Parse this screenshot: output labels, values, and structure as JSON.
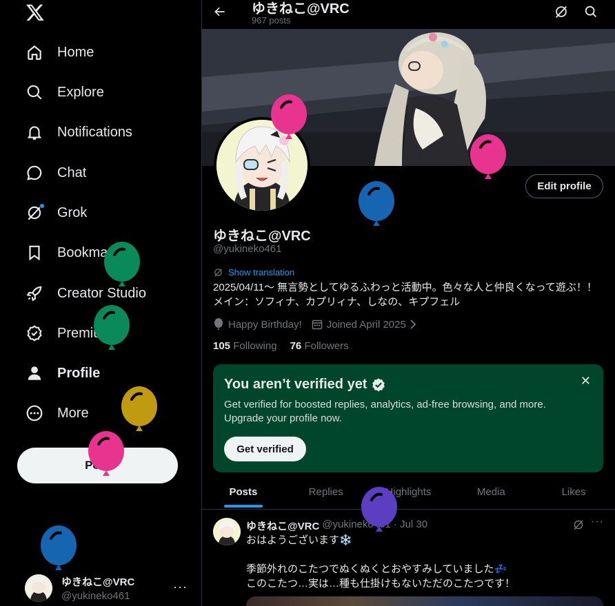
{
  "sidebar": {
    "items": [
      {
        "label": "Home",
        "icon": "home-icon"
      },
      {
        "label": "Explore",
        "icon": "search-icon"
      },
      {
        "label": "Notifications",
        "icon": "bell-icon"
      },
      {
        "label": "Chat",
        "icon": "chat-icon"
      },
      {
        "label": "Grok",
        "icon": "grok-icon"
      },
      {
        "label": "Bookmarks",
        "icon": "bookmark-icon"
      },
      {
        "label": "Creator Studio",
        "icon": "rocket-icon"
      },
      {
        "label": "Premium",
        "icon": "verified-icon"
      },
      {
        "label": "Profile",
        "icon": "person-icon"
      },
      {
        "label": "More",
        "icon": "more-circle-icon"
      }
    ],
    "post_label": "Post",
    "account": {
      "name": "ゆきねこ@VRC",
      "handle": "@yukineko461",
      "more": "···"
    }
  },
  "header": {
    "title": "ゆきねこ@VRC",
    "subtitle": "967 posts"
  },
  "profile": {
    "edit_label": "Edit profile",
    "name": "ゆきねこ@VRC",
    "handle": "@yukineko461",
    "show_translation": "Show translation",
    "bio_line1": "2025/04/11～ 無言勢としてゆるふわっと活動中。色々な人と仲良くなって遊ぶ！！",
    "bio_line2": "メイン：ソフィナ、カプリィナ、しなの、キプフェル",
    "birthday": "Happy Birthday!",
    "joined": "Joined April 2025",
    "following_count": "105",
    "following_label": "Following",
    "followers_count": "76",
    "followers_label": "Followers"
  },
  "verify_card": {
    "title": "You aren’t verified yet",
    "description": "Get verified for boosted replies, analytics, ad-free browsing, and more. Upgrade your profile now.",
    "button": "Get verified",
    "close": "✕"
  },
  "tabs": [
    "Posts",
    "Replies",
    "Highlights",
    "Media",
    "Likes"
  ],
  "tweet": {
    "name": "ゆきねこ@VRC",
    "handle_date": "@yukineko461 · Jul 30",
    "more": "···",
    "text": "おはようございます❄️\n\n季節外れのこたつでぬくぬくとおやすみしていました💤\nこのこたつ…実は…種も仕掛けもないただのこたつです！"
  },
  "colors": {
    "accent": "#1d9bf0",
    "verify_bg": "#00462d",
    "balloon_pink": "#e8338f",
    "balloon_green": "#0a8a5a",
    "balloon_blue": "#1565b0",
    "balloon_gold": "#c09a10",
    "balloon_purple": "#5b3fc0"
  }
}
